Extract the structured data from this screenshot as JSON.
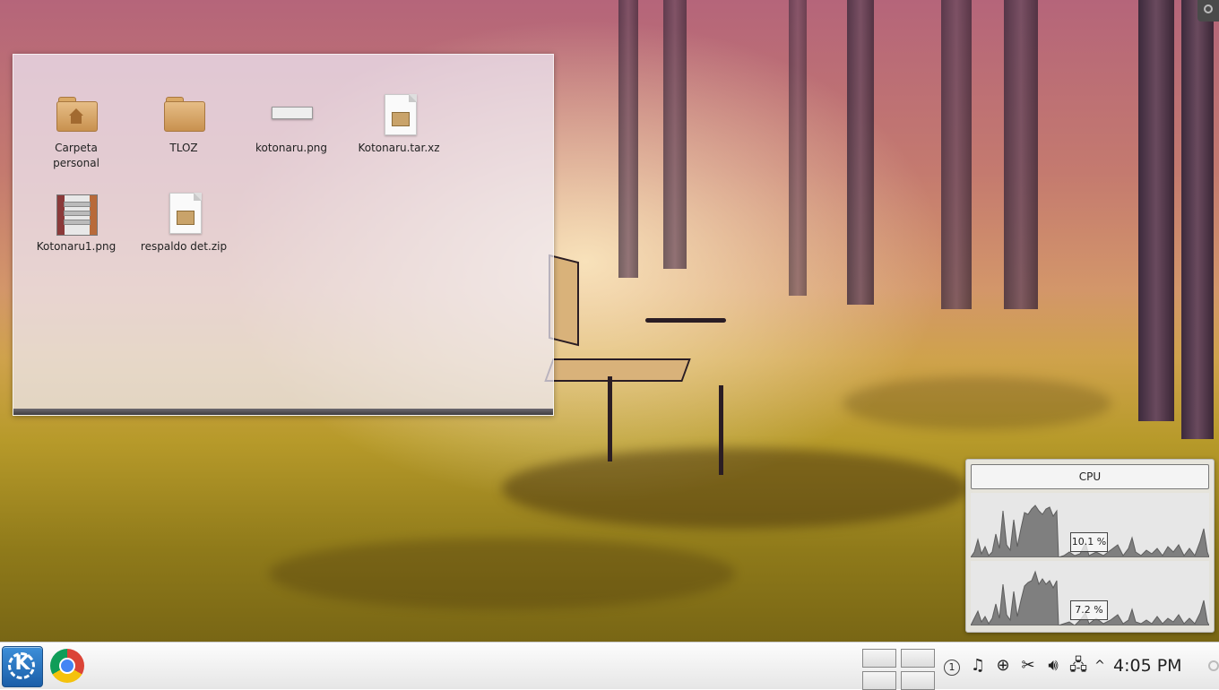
{
  "desktop": {
    "wallpaper": "autumn-park-bench",
    "icons": [
      {
        "label": "Carpeta personal",
        "type": "home-folder-icon"
      },
      {
        "label": "TLOZ",
        "type": "folder-icon"
      },
      {
        "label": "kotonaru.png",
        "type": "image-file-icon"
      },
      {
        "label": "Kotonaru.tar.xz",
        "type": "archive-file-icon"
      },
      {
        "label": "Kotonaru1.png",
        "type": "image-file-icon"
      },
      {
        "label": "respaldo det.zip",
        "type": "archive-file-icon"
      }
    ]
  },
  "cpu_widget": {
    "title": "CPU",
    "graphs": [
      {
        "value_label": "10.1 %"
      },
      {
        "value_label": "7.2 %"
      }
    ],
    "fill_color": "#7f7f7f"
  },
  "taskbar": {
    "launcher": "kde-menu-icon",
    "apps": [
      "chrome-icon"
    ],
    "virtual_desktops": 4,
    "tray": {
      "notifications_count": "1",
      "icons": [
        "music-note-icon",
        "lifebuoy-icon",
        "scissors-icon",
        "volume-icon",
        "network-icon",
        "chevron-up-icon"
      ]
    },
    "clock": "4:05 PM"
  }
}
